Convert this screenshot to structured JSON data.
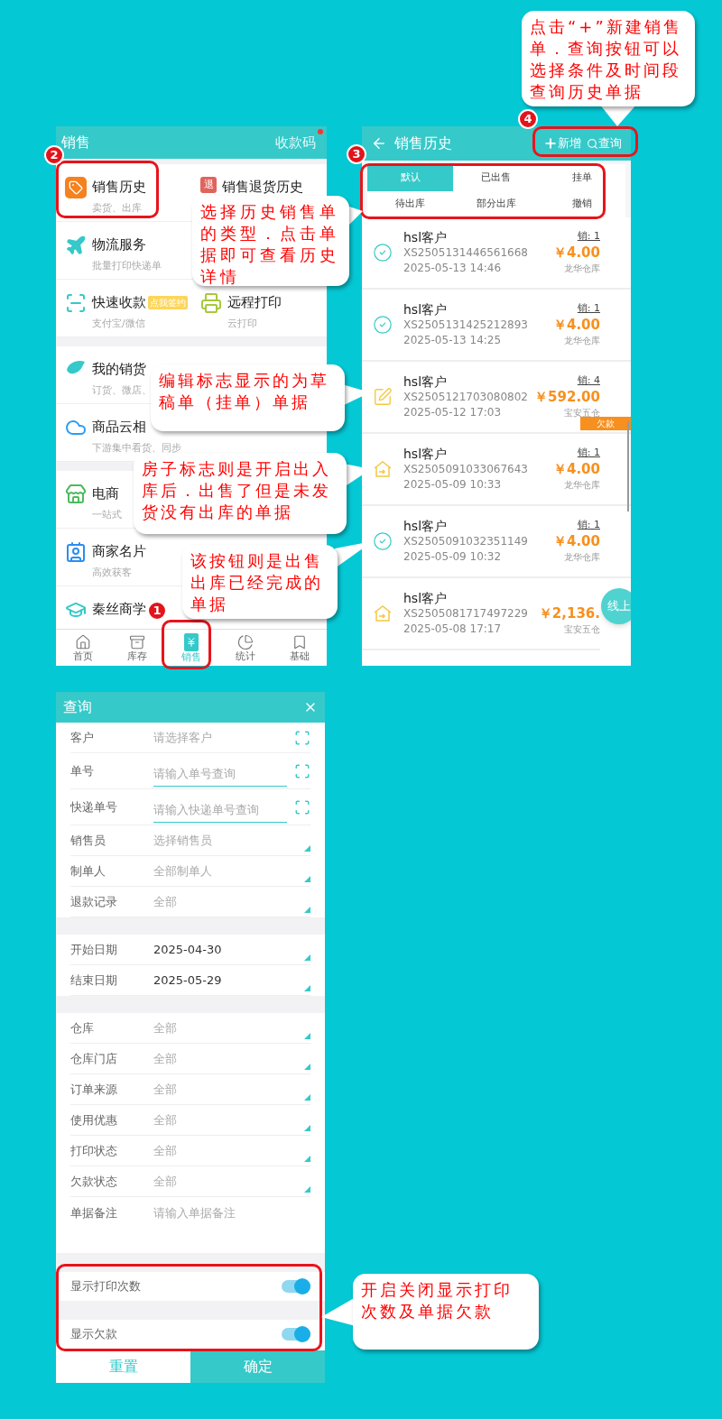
{
  "sales_menu": {
    "title": "销售",
    "action": "收款码",
    "sections": [
      {
        "rows": [
          [
            {
              "title": "销售历史",
              "subtitle": "卖货、出库"
            },
            {
              "title": "销售退货历史",
              "icon_glyph": "退"
            }
          ],
          [
            {
              "title": "物流服务",
              "subtitle": "批量打印快递单"
            }
          ],
          [
            {
              "title": "快速收款",
              "subtitle": "支付宝/微信",
              "badge": "点我签约"
            },
            {
              "title": "远程打印",
              "subtitle": "云打印"
            }
          ]
        ]
      },
      {
        "rows": [
          [
            {
              "title": "我的销货",
              "subtitle": "订货、微店、"
            }
          ],
          [
            {
              "title": "商品云相",
              "subtitle": "下游集中看货、同步"
            }
          ]
        ]
      },
      {
        "rows": [
          [
            {
              "title": "电商",
              "subtitle": "一站式"
            }
          ],
          [
            {
              "title": "商家名片",
              "subtitle": "高效获客"
            }
          ],
          [
            {
              "title": "秦丝商学"
            }
          ]
        ]
      }
    ],
    "nav": [
      {
        "label": "首页",
        "selected": false
      },
      {
        "label": "库存",
        "selected": false
      },
      {
        "label": "销售",
        "selected": true
      },
      {
        "label": "统计",
        "selected": false
      },
      {
        "label": "基础",
        "selected": false
      }
    ]
  },
  "sales_history": {
    "title": "销售历史",
    "actions": [
      {
        "label": "新增",
        "kind": "add"
      },
      {
        "label": "查询",
        "kind": "search"
      }
    ],
    "tabs": [
      {
        "label": "默认",
        "selected": true
      },
      {
        "label": "已出售",
        "selected": false
      },
      {
        "label": "挂单",
        "selected": false
      },
      {
        "label": "待出库",
        "selected": false
      },
      {
        "label": "部分出库",
        "selected": false
      },
      {
        "label": "撤销",
        "selected": false
      }
    ],
    "orders": [
      {
        "kind": "done",
        "customer": "hsl客户",
        "order_no": "XS2505131446561668",
        "date": "2025-05-13 14:46",
        "count": "销: 1",
        "amount": "￥4.00",
        "warehouse": "龙华仓库"
      },
      {
        "kind": "done",
        "customer": "hsl客户",
        "order_no": "XS2505131425212893",
        "date": "2025-05-13 14:25",
        "count": "销: 1",
        "amount": "￥4.00",
        "warehouse": "龙华仓库"
      },
      {
        "kind": "draft",
        "customer": "hsl客户",
        "order_no": "XS2505121703080802",
        "date": "2025-05-12 17:03",
        "count": "销: 4",
        "amount": "￥592.00",
        "warehouse": "宝安五仓",
        "tag": "欠款"
      },
      {
        "kind": "house",
        "customer": "hsl客户",
        "order_no": "XS2505091033067643",
        "date": "2025-05-09 10:33",
        "count": "销: 1",
        "amount": "￥4.00",
        "warehouse": "龙华仓库"
      },
      {
        "kind": "done",
        "customer": "hsl客户",
        "order_no": "XS2505091032351149",
        "date": "2025-05-09 10:32",
        "count": "销: 1",
        "amount": "￥4.00",
        "warehouse": "龙华仓库"
      },
      {
        "kind": "house",
        "customer": "hsl客户",
        "order_no": "XS2505081717497229",
        "date": "2025-05-08 17:17",
        "amount": "￥2,136.",
        "warehouse": "宝安五仓"
      }
    ],
    "float_button": "线上"
  },
  "query_form": {
    "title": "查询",
    "sections": [
      {
        "fields": [
          {
            "kind": "scan",
            "label": "客户",
            "placeholder": "请选择客户"
          },
          {
            "kind": "input",
            "label": "单号",
            "placeholder": "请输入单号查询"
          },
          {
            "kind": "input",
            "label": "快递单号",
            "placeholder": "请输入快递单号查询"
          },
          {
            "kind": "select",
            "label": "销售员",
            "placeholder": "选择销售员"
          },
          {
            "kind": "select",
            "label": "制单人",
            "placeholder": "全部制单人"
          },
          {
            "kind": "select",
            "label": "退款记录",
            "placeholder": "全部"
          }
        ]
      },
      {
        "fields": [
          {
            "kind": "select",
            "label": "开始日期",
            "value": "2025-04-30"
          },
          {
            "kind": "select",
            "label": "结束日期",
            "value": "2025-05-29"
          }
        ]
      },
      {
        "fields": [
          {
            "kind": "select",
            "label": "仓库",
            "placeholder": "全部"
          },
          {
            "kind": "select",
            "label": "仓库门店",
            "placeholder": "全部"
          },
          {
            "kind": "select",
            "label": "订单来源",
            "placeholder": "全部"
          },
          {
            "kind": "select",
            "label": "使用优惠",
            "placeholder": "全部"
          },
          {
            "kind": "select",
            "label": "打印状态",
            "placeholder": "全部"
          },
          {
            "kind": "select",
            "label": "欠款状态",
            "placeholder": "全部"
          },
          {
            "kind": "textarea",
            "label": "单据备注",
            "placeholder": "请输入单据备注"
          }
        ]
      }
    ],
    "toggles": [
      {
        "label": "显示打印次数",
        "on": true
      },
      {
        "label": "显示欠款",
        "on": true
      }
    ],
    "buttons": [
      {
        "label": "重置",
        "kind": "secondary"
      },
      {
        "label": "确定",
        "kind": "primary"
      }
    ]
  },
  "annotations": {
    "callouts": [
      {
        "text": "选择历史销售单的类型．点击单据即可查看历史详情"
      },
      {
        "text": "编辑标志显示的为草稿单（挂单）单据"
      },
      {
        "text": "房子标志则是开启出入库后．出售了但是未发货没有出库的单据"
      },
      {
        "text": "该按钮则是出售出库已经完成的单据"
      },
      {
        "text": "点击“+”新建销售单．查询按钮可以选择条件及时间段查询历史单据"
      },
      {
        "text": "开启关闭显示打印次数及单据欠款"
      }
    ],
    "markers": [
      {
        "number": "1"
      },
      {
        "number": "2"
      },
      {
        "number": "3"
      },
      {
        "number": "4"
      }
    ]
  }
}
